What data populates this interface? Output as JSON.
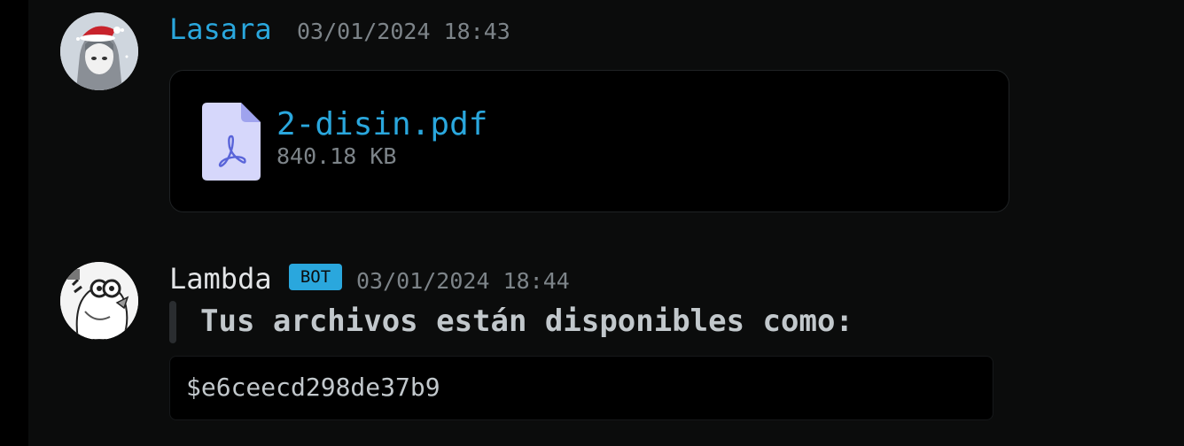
{
  "messages": [
    {
      "author": "Lasara",
      "timestamp": "03/01/2024 18:43",
      "avatar_icon": "user-avatar-anime-santa-hat",
      "attachment": {
        "file_name": "2-disin.pdf",
        "file_size": "840.18 KB",
        "icon": "pdf-file-icon"
      }
    },
    {
      "author": "Lambda",
      "badge": "BOT",
      "timestamp": "03/01/2024 18:44",
      "avatar_icon": "bot-avatar-cartoon",
      "quote": "Tus archivos están disponibles como:",
      "code": "$e6ceecd298de37b9"
    }
  ],
  "colors": {
    "background": "#0b0c0c",
    "accent": "#2aa7dd",
    "muted": "#7d8489",
    "text": "#c2c8cc",
    "username_default": "#e3e5e7"
  }
}
